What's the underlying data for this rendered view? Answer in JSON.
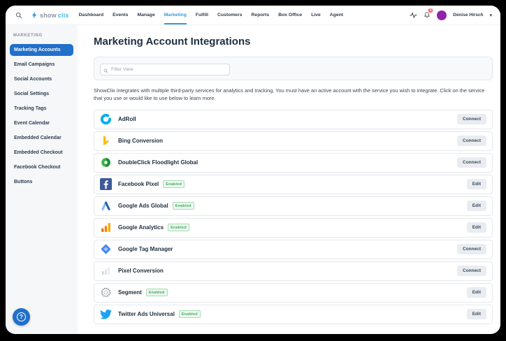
{
  "topbar": {
    "logo": {
      "brand_first": "show",
      "brand_second": "clix"
    },
    "nav": [
      {
        "label": "Dashboard",
        "active": false
      },
      {
        "label": "Events",
        "active": false
      },
      {
        "label": "Manage",
        "active": false
      },
      {
        "label": "Marketing",
        "active": true
      },
      {
        "label": "Fulfill",
        "active": false
      },
      {
        "label": "Customers",
        "active": false
      },
      {
        "label": "Reports",
        "active": false
      },
      {
        "label": "Box Office",
        "active": false
      },
      {
        "label": "Live",
        "active": false
      },
      {
        "label": "Agent",
        "active": false
      }
    ],
    "user": {
      "name": "Denise Hirsch",
      "notification_count": "3"
    }
  },
  "sidebar": {
    "section_title": "MARKETING",
    "items": [
      {
        "label": "Marketing Accounts",
        "active": true
      },
      {
        "label": "Email Campaigns",
        "active": false
      },
      {
        "label": "Social Accounts",
        "active": false
      },
      {
        "label": "Social Settings",
        "active": false
      },
      {
        "label": "Tracking Tags",
        "active": false
      },
      {
        "label": "Event Calendar",
        "active": false
      },
      {
        "label": "Embedded Calendar",
        "active": false
      },
      {
        "label": "Embedded Checkout",
        "active": false
      },
      {
        "label": "Facebook Checkout",
        "active": false
      },
      {
        "label": "Buttons",
        "active": false
      }
    ],
    "help_label": "?"
  },
  "main": {
    "title": "Marketing Account Integrations",
    "filter_placeholder": "Filter View",
    "description": "ShowClix integrates with multiple third-party services for analytics and tracking. You must have an active account with the service you wish to integrate. Click on the service that you use or would like to use below to learn more.",
    "integrations": [
      {
        "name": "AdRoll",
        "icon": "adroll-icon",
        "status": null,
        "action": "Connect"
      },
      {
        "name": "Bing Conversion",
        "icon": "bing-icon",
        "status": null,
        "action": "Connect"
      },
      {
        "name": "DoubleClick Floodlight Global",
        "icon": "doubleclick-icon",
        "status": null,
        "action": "Connect"
      },
      {
        "name": "Facebook Pixel",
        "icon": "facebook-icon",
        "status": "Enabled",
        "action": "Edit"
      },
      {
        "name": "Google Ads Global",
        "icon": "google-ads-icon",
        "status": "Enabled",
        "action": "Edit"
      },
      {
        "name": "Google Analytics",
        "icon": "google-analytics-icon",
        "status": "Enabled",
        "action": "Edit"
      },
      {
        "name": "Google Tag Manager",
        "icon": "google-tag-manager-icon",
        "status": null,
        "action": "Connect"
      },
      {
        "name": "Pixel Conversion",
        "icon": "pixel-conversion-icon",
        "status": null,
        "action": "Connect"
      },
      {
        "name": "Segment",
        "icon": "segment-icon",
        "status": "Enabled",
        "action": "Edit"
      },
      {
        "name": "Twitter Ads Universal",
        "icon": "twitter-icon",
        "status": "Enabled",
        "action": "Edit"
      }
    ]
  },
  "colors": {
    "accent_blue": "#2d9cdb",
    "sidebar_active": "#2170c9",
    "enabled_green": "#47a85f",
    "badge_red": "#ff5a5f",
    "avatar_purple": "#8e24aa"
  }
}
